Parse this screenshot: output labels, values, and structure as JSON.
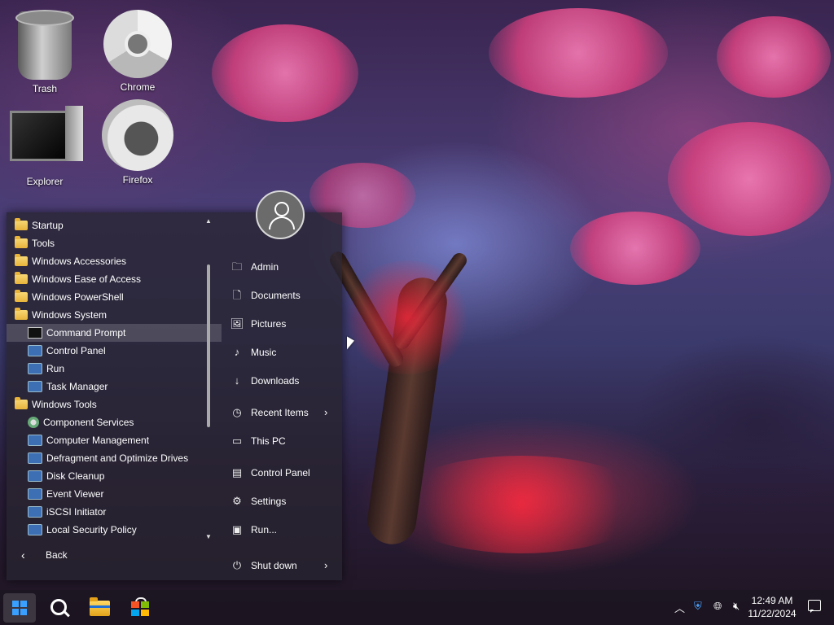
{
  "desktop": {
    "icons": [
      {
        "label": "Trash",
        "icon": "trash-icon"
      },
      {
        "label": "Chrome",
        "icon": "chrome-icon"
      },
      {
        "label": "Explorer",
        "icon": "computer-icon"
      },
      {
        "label": "Firefox",
        "icon": "firefox-icon"
      }
    ]
  },
  "start_menu": {
    "programs": [
      {
        "label": "Startup",
        "icon": "folder-icon",
        "level": 0
      },
      {
        "label": "Tools",
        "icon": "folder-icon",
        "level": 0
      },
      {
        "label": "Windows Accessories",
        "icon": "folder-icon",
        "level": 0
      },
      {
        "label": "Windows Ease of Access",
        "icon": "folder-icon",
        "level": 0
      },
      {
        "label": "Windows PowerShell",
        "icon": "folder-icon",
        "level": 0
      },
      {
        "label": "Windows System",
        "icon": "folder-icon",
        "level": 0
      },
      {
        "label": "Command Prompt",
        "icon": "cmd-icon",
        "level": 1,
        "selected": true
      },
      {
        "label": "Control Panel",
        "icon": "control-panel-icon",
        "level": 1
      },
      {
        "label": "Run",
        "icon": "run-icon",
        "level": 1
      },
      {
        "label": "Task Manager",
        "icon": "task-manager-icon",
        "level": 1
      },
      {
        "label": "Windows Tools",
        "icon": "folder-icon",
        "level": 0
      },
      {
        "label": "Component Services",
        "icon": "component-services-icon",
        "level": 1
      },
      {
        "label": "Computer Management",
        "icon": "computer-management-icon",
        "level": 1
      },
      {
        "label": "Defragment and Optimize Drives",
        "icon": "defrag-icon",
        "level": 1
      },
      {
        "label": "Disk Cleanup",
        "icon": "disk-cleanup-icon",
        "level": 1
      },
      {
        "label": "Event Viewer",
        "icon": "event-viewer-icon",
        "level": 1
      },
      {
        "label": "iSCSI Initiator",
        "icon": "iscsi-icon",
        "level": 1
      },
      {
        "label": "Local Security Policy",
        "icon": "security-policy-icon",
        "level": 1
      }
    ],
    "back_label": "Back",
    "right_items": [
      {
        "label": "Admin",
        "icon": "user-folder-icon"
      },
      {
        "label": "Documents",
        "icon": "document-icon"
      },
      {
        "label": "Pictures",
        "icon": "picture-icon"
      },
      {
        "label": "Music",
        "icon": "music-icon"
      },
      {
        "label": "Downloads",
        "icon": "download-icon"
      },
      {
        "label": "Recent Items",
        "icon": "clock-icon",
        "submenu": true
      },
      {
        "label": "This PC",
        "icon": "pc-icon"
      },
      {
        "label": "Control Panel",
        "icon": "control-panel-icon"
      },
      {
        "label": "Settings",
        "icon": "gear-icon"
      },
      {
        "label": "Run...",
        "icon": "run-icon"
      },
      {
        "label": "Shut down",
        "icon": "power-icon",
        "submenu": true
      }
    ]
  },
  "taskbar": {
    "clock_time": "12:49 AM",
    "clock_date": "11/22/2024"
  }
}
